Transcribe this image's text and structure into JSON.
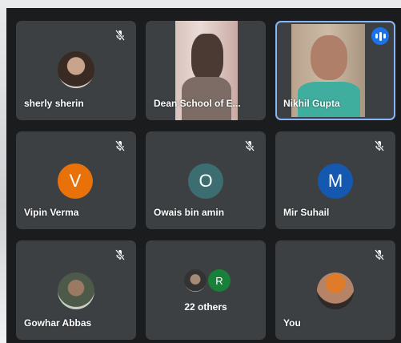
{
  "participants": [
    {
      "name": "sherly sherin",
      "muted": true
    },
    {
      "name": "Dean School of E...",
      "muted": false
    },
    {
      "name": "Nikhil Gupta",
      "muted": false,
      "speaking": true
    },
    {
      "name": "Vipin Verma",
      "initial": "V",
      "color": "#e8710a",
      "muted": true
    },
    {
      "name": "Owais bin amin",
      "initial": "O",
      "color": "#3c6e71",
      "muted": true
    },
    {
      "name": "Mir Suhail",
      "initial": "M",
      "color": "#1558b0",
      "muted": true
    },
    {
      "name": "Gowhar Abbas",
      "muted": true
    },
    {
      "name": "You",
      "muted": true
    }
  ],
  "others": {
    "label": "22 others",
    "badge_initial": "R",
    "badge_color": "#188038"
  },
  "icons": {
    "mute": "mic-off-icon",
    "speaking": "speaking-indicator-icon"
  },
  "colors": {
    "tile_bg": "#3c4043",
    "active_outline": "#8ab4f8",
    "speaking_bg": "#1a73e8"
  }
}
